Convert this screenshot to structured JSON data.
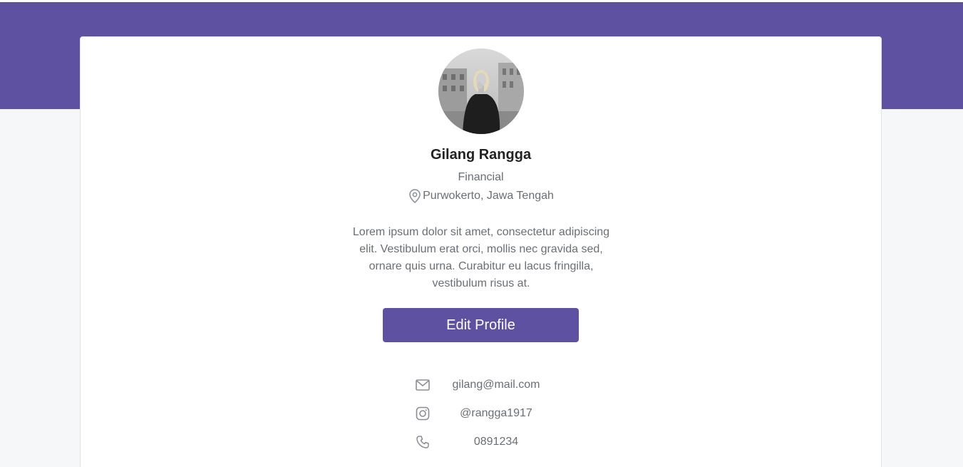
{
  "colors": {
    "accent": "#5e51a2",
    "page_background": "#f6f7f9",
    "card_background": "#ffffff",
    "muted_text": "#6b6e74",
    "heading_text": "#222222"
  },
  "profile": {
    "avatar_icon": "profile-photo",
    "name": "Gilang Rangga",
    "role": "Financial",
    "location_icon": "map-pin-icon",
    "location": "Purwokerto, Jawa Tengah",
    "bio": "Lorem ipsum dolor sit amet, consectetur adipiscing elit. Vestibulum erat orci, mollis nec gravida sed, ornare quis urna. Curabitur eu lacus fringilla, vestibulum risus at.",
    "edit_button_label": "Edit Profile"
  },
  "contacts": [
    {
      "icon": "mail-icon",
      "value": "gilang@mail.com"
    },
    {
      "icon": "instagram-icon",
      "value": "@rangga1917"
    },
    {
      "icon": "phone-icon",
      "value": "0891234"
    }
  ]
}
